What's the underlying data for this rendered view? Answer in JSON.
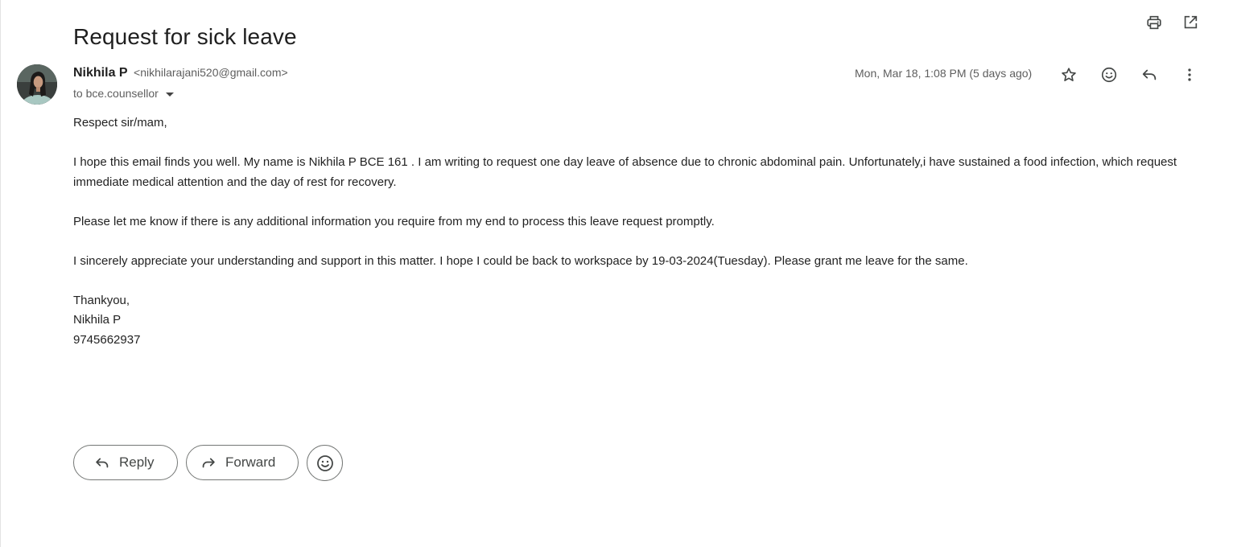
{
  "email": {
    "subject": "Request for sick leave",
    "sender_name": "Nikhila P",
    "sender_email": "<nikhilarajani520@gmail.com>",
    "to_line": "to bce.counsellor",
    "date": "Mon, Mar 18, 1:08 PM (5 days ago)"
  },
  "body": {
    "greeting": "Respect sir/mam,",
    "para1": "I hope this email finds you well. My name is Nikhila P BCE 161 . I am writing to request one day leave of absence due to chronic abdominal pain. Unfortunately,i have sustained a food infection, which request immediate medical attention and the day of rest for recovery.",
    "para2": "Please let me know if there is any additional information you require from my end to process this leave request promptly.",
    "para3": "I sincerely appreciate your understanding and support in this matter. I hope I could be back to workspace by 19-03-2024(Tuesday). Please grant me leave for the same.",
    "closing": "Thankyou,",
    "signature_name": "Nikhila P",
    "signature_phone": "9745662937"
  },
  "actions": {
    "reply_label": "Reply",
    "forward_label": "Forward"
  },
  "icons": {
    "print": "print-icon",
    "open_new_window": "open-in-new-window-icon",
    "star": "star-icon",
    "emoji": "emoji-icon",
    "reply": "reply-icon",
    "more": "more-vertical-icon",
    "forward": "forward-icon"
  },
  "colors": {
    "text": "#1f1f1f",
    "secondary_text": "#5e5e5e",
    "button_border": "#747775"
  }
}
